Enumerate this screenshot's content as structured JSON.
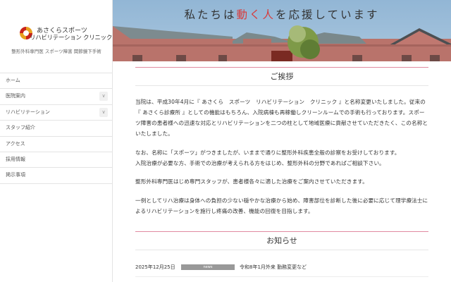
{
  "sidebar": {
    "logo": {
      "line1": "あさくらスポーツ",
      "line2": "リハビリテーション クリニック"
    },
    "tagline": "整形外科専門医 スポーツ障害 関節鏡下手術",
    "nav": [
      {
        "label": "ホーム"
      },
      {
        "label": "医院案内",
        "expand": "∨"
      },
      {
        "label": "リハビリテーション",
        "expand": "∨"
      },
      {
        "label": "スタッフ紹介"
      },
      {
        "label": "アクセス"
      },
      {
        "label": "採用情報"
      },
      {
        "label": "掲示事項"
      }
    ]
  },
  "hero": {
    "pre": "私たちは",
    "accent": "動く人",
    "post": "を応援しています",
    "accent_color": "#d83a3a"
  },
  "greeting": {
    "title": "ご挨拶",
    "paragraphs": [
      "当院は、平成30年4月に『 あさくら　スポーツ　リハビリテーション　クリニック 』と名称変更いたしました。従来の『 あさくら診療所 』としての機能はもちろん、入院病棟も再稼働しクリーンルームでの手術も行っております。スポーツ障害の患者様への迅速な対応とリハビリテーションを二つの柱として地域医療に貢献させていただきたく、この名称といたしました。",
      "なお、名称に「スポーツ」がつきましたが、いままで通りに整形外科疾患全般の診察をお受けしております。",
      "入院治療が必要な方、手術での治療が考えられる方をはじめ、整形外科の分野であればご相談下さい。",
      "整形外科専門医はじめ専門スタッフが、患者様各々に適した治療をご案内させていただきます。",
      "一例としてリハ治療は身体への負担の少ない穏やかな治療から始め、障害部位を診断した後に必要に応じて理学療法士によるリハビリテーションを施行し疼痛の改善、機能の回復を目指します。"
    ]
  },
  "news": {
    "title": "お知らせ",
    "items": [
      {
        "date": "2025年12月25日",
        "category": "news",
        "title": "令和8年1月外来 勤務変更など"
      }
    ]
  }
}
